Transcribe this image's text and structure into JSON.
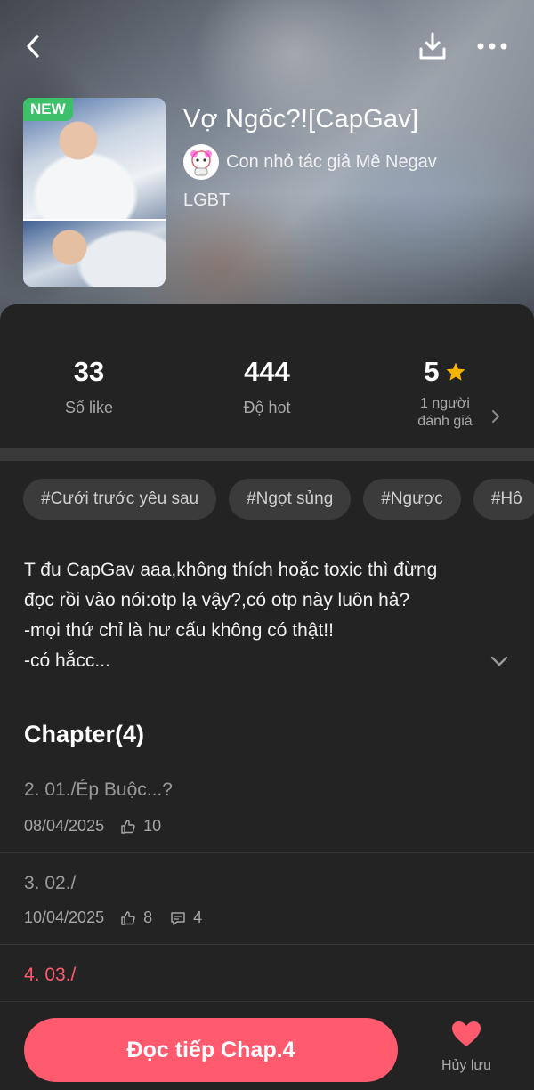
{
  "header": {
    "badge": "NEW",
    "title": "Vợ Ngốc?![CapGav]",
    "author": "Con nhỏ tác giả Mê Negav",
    "genre": "LGBT",
    "icons": {
      "back": "chevron-left-icon",
      "download": "download-icon",
      "more": "more-horizontal-icon"
    }
  },
  "stats": {
    "likes": {
      "value": "33",
      "label": "Số like"
    },
    "hot": {
      "value": "444",
      "label": "Độ hot"
    },
    "rating": {
      "value": "5",
      "label_line1": "1 người",
      "label_line2": "đánh giá",
      "star_color": "#f5b400"
    }
  },
  "tags": [
    "#Cưới trước yêu sau",
    "#Ngọt sủng",
    "#Ngược",
    "#Hô"
  ],
  "description": {
    "lines": [
      "T đu CapGav aaa,không thích hoặc toxic thì đừng",
      "đọc rồi vào nói:otp lạ vậy?,có otp này luôn hả?",
      "-mọi thứ chỉ là hư cấu không có thật!!",
      "-có hắcc..."
    ]
  },
  "chapters": {
    "heading": "Chapter(4)",
    "items": [
      {
        "title": "2. 01./Ép Buộc...?",
        "date": "08/04/2025",
        "likes": "10",
        "comments": ""
      },
      {
        "title": "3. 02./",
        "date": "10/04/2025",
        "likes": "8",
        "comments": "4"
      },
      {
        "title": "4. 03./",
        "date": "",
        "likes": "",
        "comments": ""
      }
    ]
  },
  "bottom": {
    "read_label": "Đọc tiếp Chap.4",
    "save_label": "Hủy lưu",
    "accent": "#ff5a6e"
  }
}
